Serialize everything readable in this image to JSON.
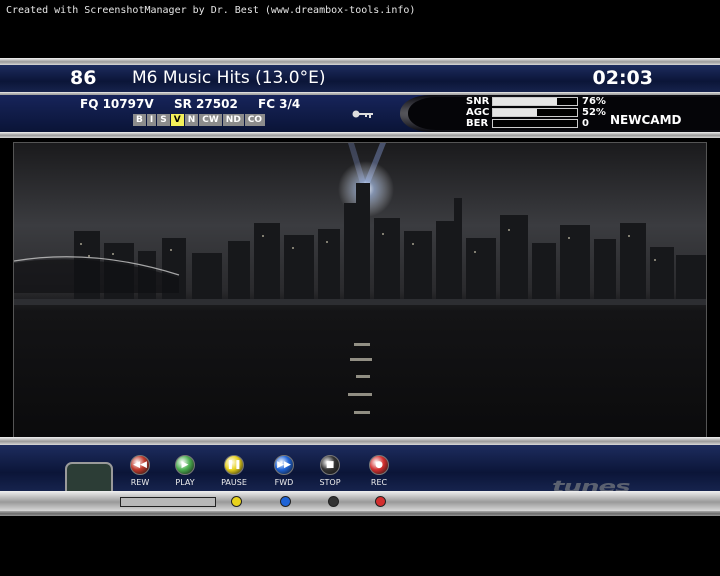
{
  "credit": "Created with ScreenshotManager by Dr. Best (www.dreambox-tools.info)",
  "infobar": {
    "channel_number": "86",
    "channel_name": "M6 Music Hits (13.0°E)",
    "clock": "02:03"
  },
  "tuner": {
    "frequency": "FQ 10797V",
    "symbol_rate": "SR 27502",
    "fec": "FC 3/4",
    "systems": [
      {
        "label": "B",
        "active": false
      },
      {
        "label": "I",
        "active": false
      },
      {
        "label": "S",
        "active": false
      },
      {
        "label": "V",
        "active": true
      },
      {
        "label": "N",
        "active": false
      },
      {
        "label": "CW",
        "active": false
      },
      {
        "label": "ND",
        "active": false
      },
      {
        "label": "CO",
        "active": false
      }
    ],
    "signal": [
      {
        "label": "SNR",
        "value": "76%",
        "fraction": 0.76
      },
      {
        "label": "AGC",
        "value": "52%",
        "fraction": 0.52
      },
      {
        "label": "BER",
        "value": "0",
        "fraction": 0
      }
    ],
    "cam": "NEWCAMD"
  },
  "controls": [
    {
      "label": "REW",
      "color": "#c0392b",
      "glyph": "◀◀"
    },
    {
      "label": "PLAY",
      "color": "#4caf50",
      "glyph": "▶"
    },
    {
      "label": "PAUSE",
      "color": "#e8d21c",
      "glyph": "❚❚"
    },
    {
      "label": "FWD",
      "color": "#1e63d6",
      "glyph": "▶▶"
    },
    {
      "label": "STOP",
      "color": "#333333",
      "glyph": "■"
    },
    {
      "label": "REC",
      "color": "#d32f2f",
      "glyph": "●"
    }
  ],
  "color_keys": [
    "#e8d21c",
    "#1e63d6",
    "#333333",
    "#d32f2f"
  ],
  "progress_fraction": 0
}
